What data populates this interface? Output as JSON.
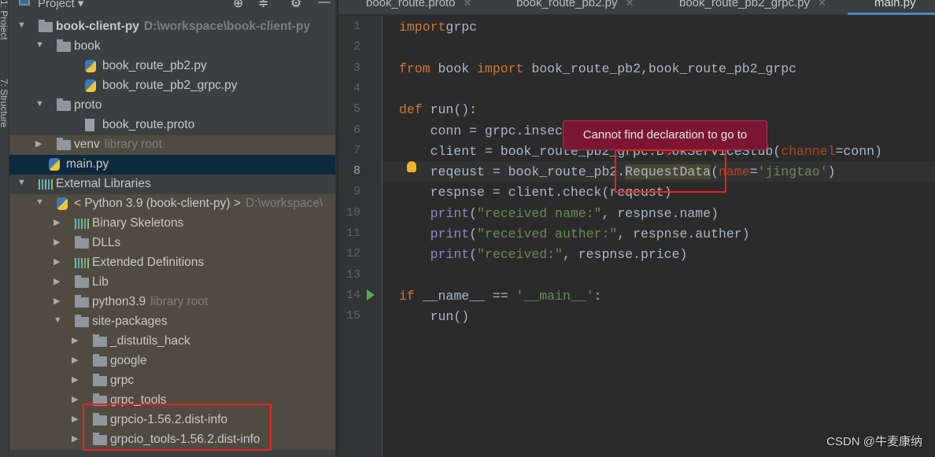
{
  "side_tabs": {
    "project": "1: Project",
    "structure": "7: Structure"
  },
  "project_panel": {
    "title": "Project",
    "icons": [
      "locate-icon",
      "collapse-icon",
      "gear-icon",
      "minimize-icon"
    ]
  },
  "tree": [
    {
      "label": "book-client-py",
      "hint": "D:\\workspace\\book-client-py",
      "type": "folder",
      "depth": 0,
      "expanded": true,
      "bold": true
    },
    {
      "label": "book",
      "type": "folder",
      "depth": 1,
      "expanded": true
    },
    {
      "label": "book_route_pb2.py",
      "type": "python",
      "depth": 2
    },
    {
      "label": "book_route_pb2_grpc.py",
      "type": "python",
      "depth": 2
    },
    {
      "label": "proto",
      "type": "folder",
      "depth": 1,
      "expanded": true
    },
    {
      "label": "book_route.proto",
      "type": "file",
      "depth": 2
    },
    {
      "label": "venv",
      "hint": "library root",
      "type": "folder",
      "depth": 1,
      "expanded": false,
      "lib": true
    },
    {
      "label": "main.py",
      "type": "python",
      "depth": 1,
      "selected": true
    },
    {
      "label": "External Libraries",
      "type": "library",
      "depth": 0,
      "expanded": true
    },
    {
      "label": "< Python 3.9 (book-client-py) >",
      "hint": "D:\\workspace\\",
      "type": "python-sdk",
      "depth": 1,
      "expanded": true,
      "lib": true
    },
    {
      "label": "Binary Skeletons",
      "type": "library",
      "depth": 2,
      "expanded": false,
      "lib": true
    },
    {
      "label": "DLLs",
      "type": "folder",
      "depth": 2,
      "expanded": false,
      "lib": true
    },
    {
      "label": "Extended Definitions",
      "type": "library",
      "depth": 2,
      "expanded": false,
      "lib": true
    },
    {
      "label": "Lib",
      "type": "folder",
      "depth": 2,
      "expanded": false,
      "lib": true
    },
    {
      "label": "python3.9",
      "hint": "library root",
      "type": "folder",
      "depth": 2,
      "expanded": false,
      "lib": true
    },
    {
      "label": "site-packages",
      "type": "folder",
      "depth": 2,
      "expanded": true,
      "lib": true
    },
    {
      "label": "_distutils_hack",
      "type": "folder",
      "depth": 3,
      "expanded": false,
      "lib": true
    },
    {
      "label": "google",
      "type": "folder",
      "depth": 3,
      "expanded": false,
      "lib": true
    },
    {
      "label": "grpc",
      "type": "folder",
      "depth": 3,
      "expanded": false,
      "lib": true
    },
    {
      "label": "grpc_tools",
      "type": "folder",
      "depth": 3,
      "expanded": false,
      "lib": true
    },
    {
      "label": "grpcio-1.56.2.dist-info",
      "type": "folder",
      "depth": 3,
      "expanded": false,
      "lib": true
    },
    {
      "label": "grpcio_tools-1.56.2.dist-info",
      "type": "folder",
      "depth": 3,
      "expanded": false,
      "lib": true
    }
  ],
  "tabs": [
    {
      "label": "book_route.proto",
      "icon": "proto-file-icon"
    },
    {
      "label": "book_route_pb2.py",
      "icon": "python-file-icon"
    },
    {
      "label": "book_route_pb2_grpc.py",
      "icon": "python-file-icon"
    },
    {
      "label": "main.py",
      "icon": "python-file-icon",
      "active": true
    }
  ],
  "code": {
    "current_line": 8,
    "lines": [
      [
        [
          "kw",
          "import"
        ],
        [
          "",
          "grpc"
        ]
      ],
      [],
      [
        [
          "kw",
          "from"
        ],
        [
          "",
          " book "
        ],
        [
          "kw",
          "import"
        ],
        [
          "",
          " book_route_pb2,book_route_pb2_grpc"
        ]
      ],
      [],
      [
        [
          "kw",
          "def"
        ],
        [
          "",
          " run():"
        ]
      ],
      [
        [
          "",
          "    conn = grpc.insec"
        ],
        [
          "",
          "                      "
        ],
        [
          "str",
          "8'"
        ],
        [
          "",
          ")"
        ]
      ],
      [
        [
          "",
          "    client = book_route_pb2_grpc.BookServiceStub("
        ],
        [
          "par",
          "channel"
        ],
        [
          "",
          "=conn)"
        ]
      ],
      [
        [
          "",
          "    reqeust = book_route_pb2."
        ],
        [
          "hl",
          "RequestData"
        ],
        [
          "",
          "("
        ],
        [
          "par",
          "name"
        ],
        [
          "",
          "="
        ],
        [
          "str",
          "'jingtao'"
        ],
        [
          "",
          ")"
        ]
      ],
      [
        [
          "",
          "    respnse = client.check(reqeust)"
        ]
      ],
      [
        [
          "",
          "    "
        ],
        [
          "fn",
          "print"
        ],
        [
          "",
          "("
        ],
        [
          "str",
          "\"received name:\""
        ],
        [
          "",
          ", respnse.name)"
        ]
      ],
      [
        [
          "",
          "    "
        ],
        [
          "fn",
          "print"
        ],
        [
          "",
          "("
        ],
        [
          "str",
          "\"received auther:\""
        ],
        [
          "",
          ", respnse.auther)"
        ]
      ],
      [
        [
          "",
          "    "
        ],
        [
          "fn",
          "print"
        ],
        [
          "",
          "("
        ],
        [
          "str",
          "\"received:\""
        ],
        [
          "",
          ", respnse.price)"
        ]
      ],
      [],
      [
        [
          "kw",
          "if"
        ],
        [
          "",
          " __name__ == "
        ],
        [
          "str",
          "'__main__'"
        ],
        [
          "",
          ":"
        ]
      ],
      [
        [
          "",
          "    run()"
        ]
      ]
    ]
  },
  "tooltip": "Cannot find declaration to go to",
  "colors": {
    "highlight_box": "#f02020",
    "tooltip_bg": "#7a1633",
    "keyword": "#cc7832",
    "string": "#6a8759"
  },
  "watermark": "CSDN @牛麦康纳"
}
